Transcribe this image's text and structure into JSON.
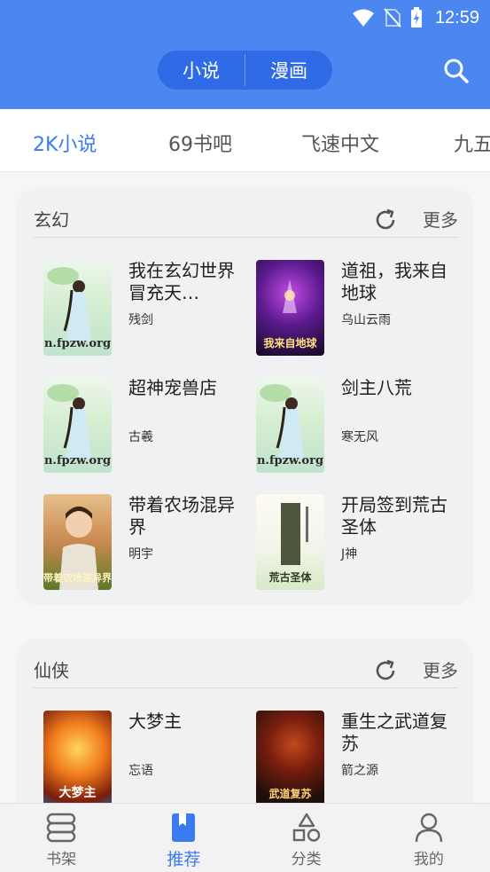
{
  "status_bar": {
    "time": "12:59"
  },
  "header": {
    "toggle": [
      "小说",
      "漫画"
    ]
  },
  "tabs": [
    "2K小说",
    "69书吧",
    "飞速中文",
    "九五"
  ],
  "sections": [
    {
      "title": "玄幻",
      "more": "更多",
      "books": [
        {
          "title": "我在玄幻世界冒充天…",
          "author": "残剑",
          "cover_text": "n.fpzw.org"
        },
        {
          "title": "道祖，我来自地球",
          "author": "乌山云雨",
          "cover_text": "我来自地球"
        },
        {
          "title": "超神宠兽店",
          "author": "古羲",
          "cover_text": "n.fpzw.org"
        },
        {
          "title": "剑主八荒",
          "author": "寒无风",
          "cover_text": "n.fpzw.org"
        },
        {
          "title": "带着农场混异界",
          "author": "明宇",
          "cover_text": "带着农场混异界"
        },
        {
          "title": "开局签到荒古圣体",
          "author": "J神",
          "cover_text": "荒古圣体"
        }
      ]
    },
    {
      "title": "仙侠",
      "more": "更多",
      "books": [
        {
          "title": "大梦主",
          "author": "忘语",
          "cover_text": "大梦主"
        },
        {
          "title": "重生之武道复苏",
          "author": "箭之源",
          "cover_text": "武道复苏"
        }
      ]
    }
  ],
  "bottom_nav": [
    {
      "label": "书架",
      "icon": "bookshelf-icon"
    },
    {
      "label": "推荐",
      "icon": "bookmark-icon"
    },
    {
      "label": "分类",
      "icon": "category-icon"
    },
    {
      "label": "我的",
      "icon": "user-icon"
    }
  ],
  "colors": {
    "primary": "#4b86f1",
    "accent": "#3a7bf0"
  }
}
